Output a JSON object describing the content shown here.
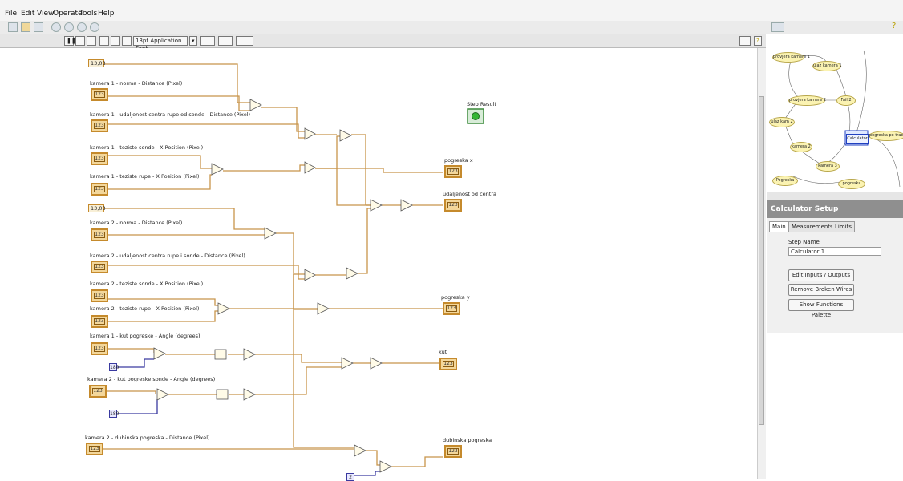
{
  "menu": [
    "File",
    "Edit",
    "View",
    "Operate",
    "Tools",
    "Help"
  ],
  "toolbar": {
    "font_select": "13pt Application Font"
  },
  "diagram": {
    "constants": {
      "c1": "13,03",
      "c2": "13,03",
      "c_deg": "180",
      "c_deg2": "180",
      "c_two": "2"
    },
    "indicators": {
      "k1_norma": "kamera 1 - norma - Distance (Pixel)",
      "k1_udalj": "kamera 1 - udaljenost centra rupe od sonde - Distance (Pixel)",
      "k1_teziste_sonde": "kamera 1 - teziste sonde - X Position (Pixel)",
      "k1_teziste_rupe": "kamera 1 - teziste rupe - X Position (Pixel)",
      "k2_norma": "kamera 2 - norma - Distance (Pixel)",
      "k2_udalj": "kamera 2 - udaljenost centra rupe i sonde - Distance (Pixel)",
      "k2_teziste_sonde": "kamera 2 - teziste sonde - X Position (Pixel)",
      "k2_teziste_rupe": "kamera 2 - teziste rupe - X Position (Pixel)",
      "k1_kut": "kamera 1 - kut pogreske - Angle (degrees)",
      "k2_kut": "kamera 2 - kut pogreske sonde - Angle (degrees)",
      "k2_dubinska": "kamera 2 - dubinska pogreska - Distance (Pixel)"
    },
    "terminal_value": "123",
    "outputs": {
      "step_result": "Step Result",
      "pogreska_x": "pogreska x",
      "udaljenost": "udaljenost od centra",
      "pogreska_y": "pogreska y",
      "kut": "kut",
      "dubinska": "dubinska pogreska"
    }
  },
  "navigator": {
    "nodes": [
      "provjera kamere 1",
      "ulaz kamera 1",
      "provjera kamere 2",
      "Fail 2",
      "ulaz kam 2",
      "kamera 2",
      "kamera 3",
      "Calculator",
      "pogreska po traces",
      "Pogreska",
      "pogreska"
    ]
  },
  "setup": {
    "title": "Calculator Setup",
    "tabs": [
      "Main",
      "Measurements",
      "Limits"
    ],
    "step_name_label": "Step Name",
    "step_name_value": "Calculator 1",
    "buttons": [
      "Edit Inputs / Outputs",
      "Remove Broken Wires",
      "Show Functions Palette"
    ]
  },
  "colors": {
    "wire": "#c8944a",
    "int_wire": "#3a3aa0",
    "terminal": "#f3d79b"
  }
}
